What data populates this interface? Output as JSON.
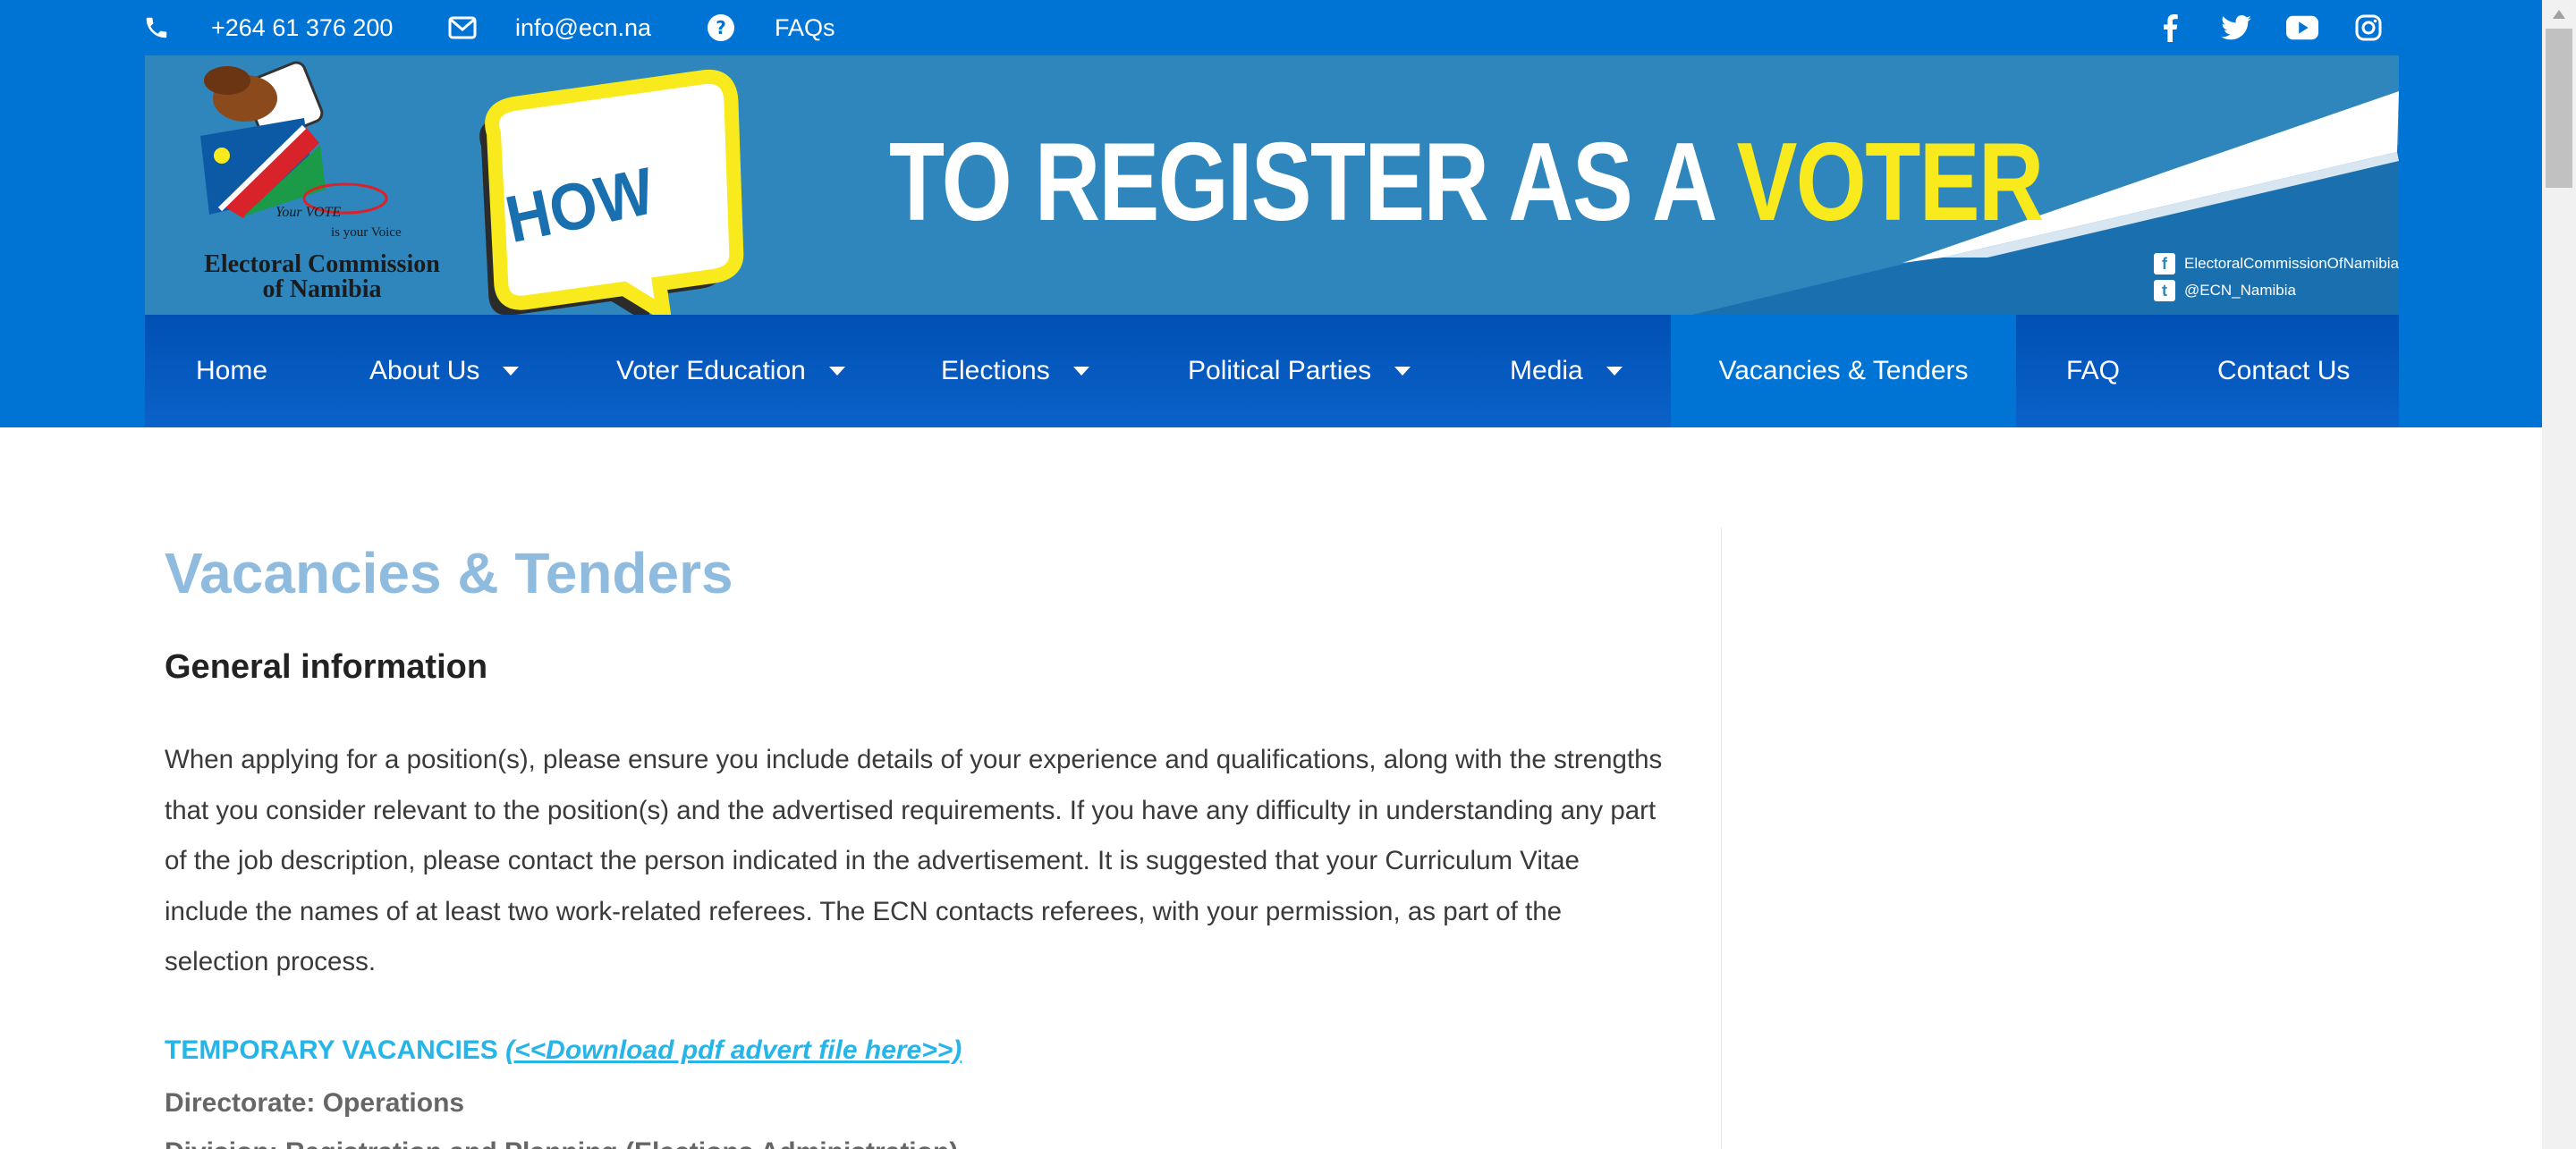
{
  "topbar": {
    "phone": "+264 61 376 200",
    "email": "info@ecn.na",
    "faqs": "FAQs",
    "icons": [
      "phone-icon",
      "envelope-icon",
      "question-circle-icon",
      "facebook-icon",
      "twitter-icon",
      "youtube-icon",
      "instagram-icon"
    ]
  },
  "banner": {
    "how_text": "HOW",
    "title_main": "TO REGISTER AS A ",
    "title_highlight": "VOTER",
    "logo_line1": "Electoral Commission",
    "logo_line2": "of Namibia",
    "logo_slogan1": "Your VOTE",
    "logo_slogan2": "is your Voice",
    "facebook_handle": "ElectoralCommissionOfNamibia",
    "twitter_handle": "@ECN_Namibia"
  },
  "nav": {
    "items": [
      {
        "label": "Home"
      },
      {
        "label": "About Us"
      },
      {
        "label": "Voter Education"
      },
      {
        "label": "Elections"
      },
      {
        "label": "Political Parties"
      },
      {
        "label": "Media"
      },
      {
        "label": "Vacancies & Tenders"
      },
      {
        "label": "FAQ"
      },
      {
        "label": "Contact Us"
      }
    ]
  },
  "content": {
    "title": "Vacancies & Tenders",
    "subtitle": "General information",
    "paragraph": "When applying for a position(s), please ensure you include details of your experience and qualifications, along with the strengths that you consider relevant to the position(s) and the advertised requirements. If you have any difficulty in understanding any part of the job description, please contact the person indicated in the advertisement. It is suggested that your Curriculum Vitae include the names of at least two work-related referees. The ECN contacts referees, with your permission, as part of the selection process.",
    "temp_vacancies": "TEMPORARY VACANCIES ",
    "download_link": "(<<Download pdf advert file here>>)",
    "directorate": "Directorate: Operations",
    "division": "Division: Registration and Planning (Elections Administration)"
  },
  "colors": {
    "brand_blue": "#0074d4",
    "banner_blue": "#2e86bc",
    "highlight_yellow": "#f8ea1c",
    "title_blue": "#8fbbdf",
    "link_cyan": "#26b5e8"
  }
}
